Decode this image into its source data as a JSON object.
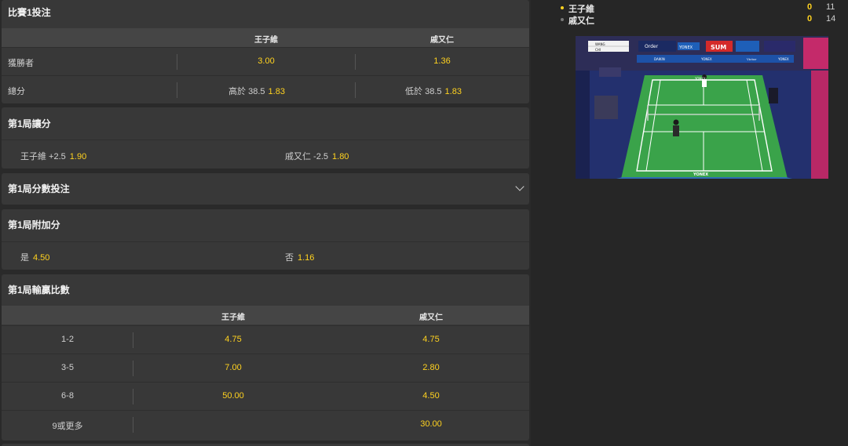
{
  "market1": {
    "title": "比賽1投注",
    "header": [
      "王子維",
      "戚又仁"
    ],
    "rows": [
      {
        "label": "獲勝者",
        "a": {
          "pre": "",
          "odd": "3.00"
        },
        "b": {
          "pre": "",
          "odd": "1.36"
        }
      },
      {
        "label": "總分",
        "a": {
          "pre": "高於 38.5",
          "odd": "1.83"
        },
        "b": {
          "pre": "低於 38.5",
          "odd": "1.83"
        }
      }
    ]
  },
  "market2": {
    "title": "第1局讓分",
    "a": {
      "pre": "王子維 +2.5",
      "odd": "1.90"
    },
    "b": {
      "pre": "戚又仁 -2.5",
      "odd": "1.80"
    }
  },
  "market3": {
    "title": "第1局分數投注"
  },
  "market4": {
    "title": "第1局附加分",
    "a": {
      "pre": "是",
      "odd": "4.50"
    },
    "b": {
      "pre": "否",
      "odd": "1.16"
    }
  },
  "market5": {
    "title": "第1局輸贏比數",
    "header": [
      "王子維",
      "戚又仁"
    ],
    "rows": [
      {
        "label": "1-2",
        "a": "4.75",
        "b": "4.75"
      },
      {
        "label": "3-5",
        "a": "7.00",
        "b": "2.80"
      },
      {
        "label": "6-8",
        "a": "50.00",
        "b": "4.50"
      },
      {
        "label": "9或更多",
        "a": "",
        "b": "30.00"
      }
    ]
  },
  "scoreboard": [
    {
      "name": "王子維",
      "games": "0",
      "points": "11",
      "serving": true
    },
    {
      "name": "戚又仁",
      "games": "0",
      "points": "14",
      "serving": false
    }
  ],
  "video": {
    "overlay_names": [
      "WANG",
      "CHI"
    ],
    "banners": [
      "Order",
      "YONEX",
      "SUM",
      "DAIKIN",
      "YONEX",
      "Victor",
      "YONEX"
    ],
    "court_text": [
      "YONEX",
      "YONEX"
    ]
  },
  "colors": {
    "odd": "#ffd21f",
    "panel": "#383838",
    "header": "#454545",
    "court": "#3aa34a",
    "court_out": "#1d2b6a"
  }
}
